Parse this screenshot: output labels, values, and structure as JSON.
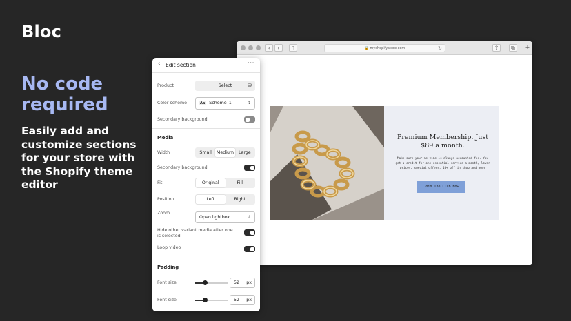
{
  "brand": "Bloc",
  "headline": "No code required",
  "subhead": "Easily add and customize sections for your store with the Shopify theme editor",
  "browser": {
    "url": "myshopifystore.com",
    "hero": {
      "title": "Premium Membership. Just $89 a month.",
      "body": "Make sure your me-time is always accounted for. You get a credit for one essential service a month, lower prices, special offers, 10% off in shop and more",
      "button": "Join The Club Now"
    }
  },
  "panel": {
    "title": "Edit section",
    "product": {
      "label": "Product",
      "value": "Select"
    },
    "color_scheme": {
      "label": "Color scheme",
      "badge": "Aa",
      "value": "Scheme_1"
    },
    "secondary_bg_1": {
      "label": "Secondary background",
      "on": false
    },
    "media": {
      "title": "Media",
      "width": {
        "label": "Width",
        "options": [
          "Small",
          "Medium",
          "Large"
        ],
        "selected": "Medium"
      },
      "secondary_bg": {
        "label": "Secondary background",
        "on": true
      },
      "fit": {
        "label": "Fit",
        "options": [
          "Original",
          "Fill"
        ],
        "selected": "Original"
      },
      "position": {
        "label": "Position",
        "options": [
          "Left",
          "Right"
        ],
        "selected": "Left"
      },
      "zoom": {
        "label": "Zoom",
        "value": "Open lightbox"
      },
      "hide_variant": {
        "label": "Hide other variant media after one is selected",
        "on": true
      },
      "loop": {
        "label": "Loop video",
        "on": true
      }
    },
    "padding": {
      "title": "Padding",
      "rows": [
        {
          "label": "Font size",
          "value": "52",
          "unit": "px",
          "fraction": 0.3
        },
        {
          "label": "Font size",
          "value": "52",
          "unit": "px",
          "fraction": 0.3
        }
      ]
    }
  },
  "colors": {
    "accent": "#a7b8f2",
    "background": "#262626",
    "button": "#7fa0d8",
    "toggle_on": "#2b2b2b",
    "toggle_off": "#8a8a8a"
  }
}
